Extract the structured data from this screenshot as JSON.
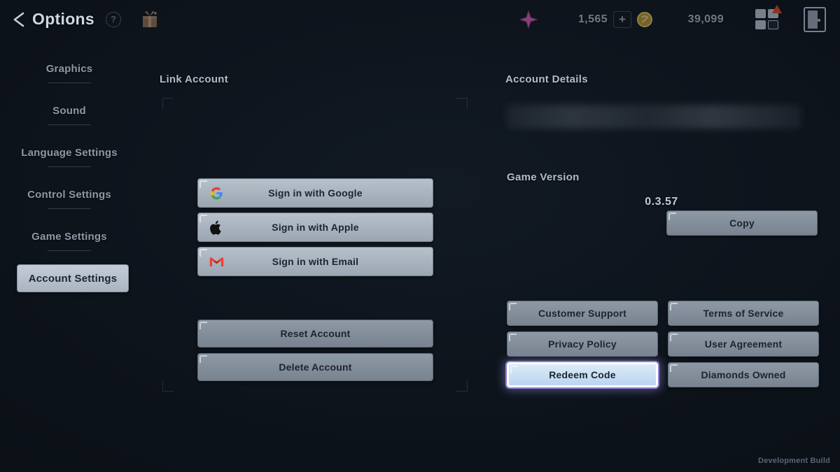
{
  "header": {
    "back_icon": "chevron-left-icon",
    "title": "Options",
    "help_icon": "?",
    "gift_icon": "gift-box-icon",
    "currencies": [
      {
        "icon": "diamond-icon",
        "value": "1,565",
        "plus_label": "+"
      },
      {
        "icon": "gold-coin-icon",
        "value": "39,099"
      }
    ],
    "grid_icon": "grid-menu-icon",
    "exit_icon": "door-exit-icon"
  },
  "sidebar": {
    "items": [
      {
        "label": "Graphics",
        "selected": false
      },
      {
        "label": "Sound",
        "selected": false
      },
      {
        "label": "Language Settings",
        "selected": false
      },
      {
        "label": "Control Settings",
        "selected": false
      },
      {
        "label": "Game Settings",
        "selected": false
      },
      {
        "label": "Account Settings",
        "selected": true
      }
    ]
  },
  "link_account": {
    "title": "Link Account",
    "signin_buttons": [
      {
        "label": "Sign in with Google",
        "brand": "google-icon"
      },
      {
        "label": "Sign in with Apple",
        "brand": "apple-icon"
      },
      {
        "label": "Sign in with Email",
        "brand": "gmail-icon"
      }
    ],
    "account_actions": [
      {
        "label": "Reset Account"
      },
      {
        "label": "Delete Account"
      }
    ]
  },
  "account_details": {
    "title": "Account Details",
    "account_id_value": "",
    "copy_label": "Copy",
    "game_version_title": "Game Version",
    "game_version_value": "0.3.57",
    "links": [
      {
        "label": "Customer Support",
        "highlighted": false
      },
      {
        "label": "Terms of Service",
        "highlighted": false
      },
      {
        "label": "Privacy Policy",
        "highlighted": false
      },
      {
        "label": "User Agreement",
        "highlighted": false
      },
      {
        "label": "Redeem Code",
        "highlighted": true
      },
      {
        "label": "Diamonds Owned",
        "highlighted": false
      }
    ]
  },
  "footer": {
    "watermark": "Development Build"
  },
  "colors": {
    "background": "#141b26",
    "button_face": "#a9b4c0",
    "highlight_border": "#ffffff",
    "highlight_glow": "#8e7fd6",
    "diamond": "#d45ab0",
    "gold": "#c9a33a",
    "badge": "#d94a23"
  }
}
